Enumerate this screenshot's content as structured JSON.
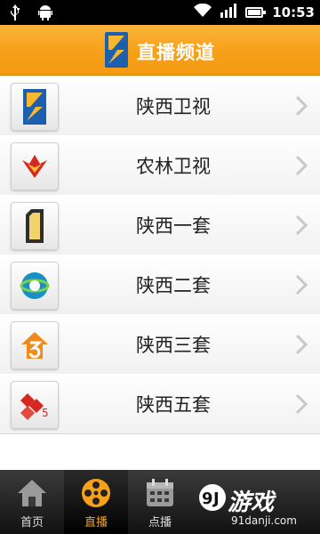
{
  "status_bar": {
    "time": "10:53",
    "battery_level": 0.85
  },
  "header": {
    "title": "直播频道"
  },
  "channels": [
    {
      "name": "陕西卫视",
      "icon": "sxtv-logo-icon"
    },
    {
      "name": "农林卫视",
      "icon": "nonglin-logo-icon"
    },
    {
      "name": "陕西一套",
      "icon": "channel1-logo-icon"
    },
    {
      "name": "陕西二套",
      "icon": "channel2-logo-icon"
    },
    {
      "name": "陕西三套",
      "icon": "channel3-logo-icon"
    },
    {
      "name": "陕西五套",
      "icon": "channel5-logo-icon"
    }
  ],
  "bottom_nav": {
    "items": [
      {
        "label": "首页",
        "icon": "home-icon"
      },
      {
        "label": "直播",
        "icon": "film-reel-icon",
        "active": true
      },
      {
        "label": "点播",
        "icon": "calendar-icon"
      }
    ]
  },
  "watermark": {
    "main": "游戏",
    "sub": "91danji.com"
  },
  "colors": {
    "accent": "#f7a11a",
    "title_text": "#ffffff",
    "nav_bg": "#1a1a1a"
  }
}
